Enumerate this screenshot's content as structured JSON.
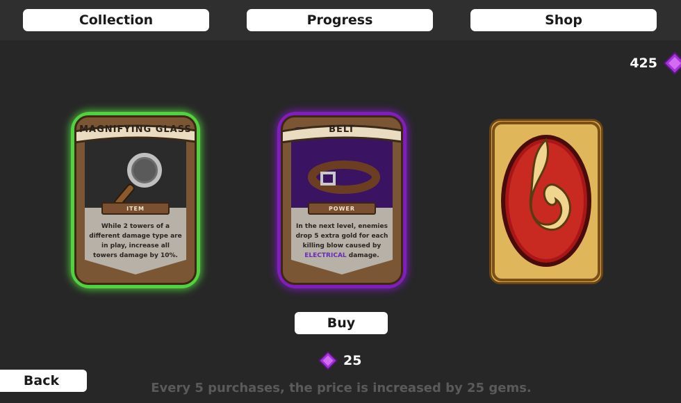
{
  "tabs": [
    {
      "label": "Collection"
    },
    {
      "label": "Progress"
    },
    {
      "label": "Shop"
    }
  ],
  "gems": {
    "total": "425",
    "icon": "gem-icon",
    "color": "#a534d6"
  },
  "cards": [
    {
      "title": "MAGNIFYING GLASS",
      "type": "ITEM",
      "description_parts": [
        "While 2 towers of a different damage type are in play, increase all towers damage by 10%."
      ],
      "icon": "magnifying-glass-icon",
      "glow_color": "#58d943"
    },
    {
      "title": "BELT",
      "type": "POWER",
      "description_before": "In the next level, enemies drop 5 extra gold for each killing blow caused by ",
      "description_highlight": "ELECTRICAL",
      "description_after": " damage.",
      "icon": "belt-icon",
      "glow_color": "#8a24c8"
    },
    {
      "back_icon": "flame-emblem-icon"
    }
  ],
  "buy": {
    "label": "Buy"
  },
  "price": {
    "value": "25",
    "icon": "gem-icon"
  },
  "back": {
    "label": "Back"
  },
  "footnote": "Every 5 purchases, the price is increased by 25 gems."
}
